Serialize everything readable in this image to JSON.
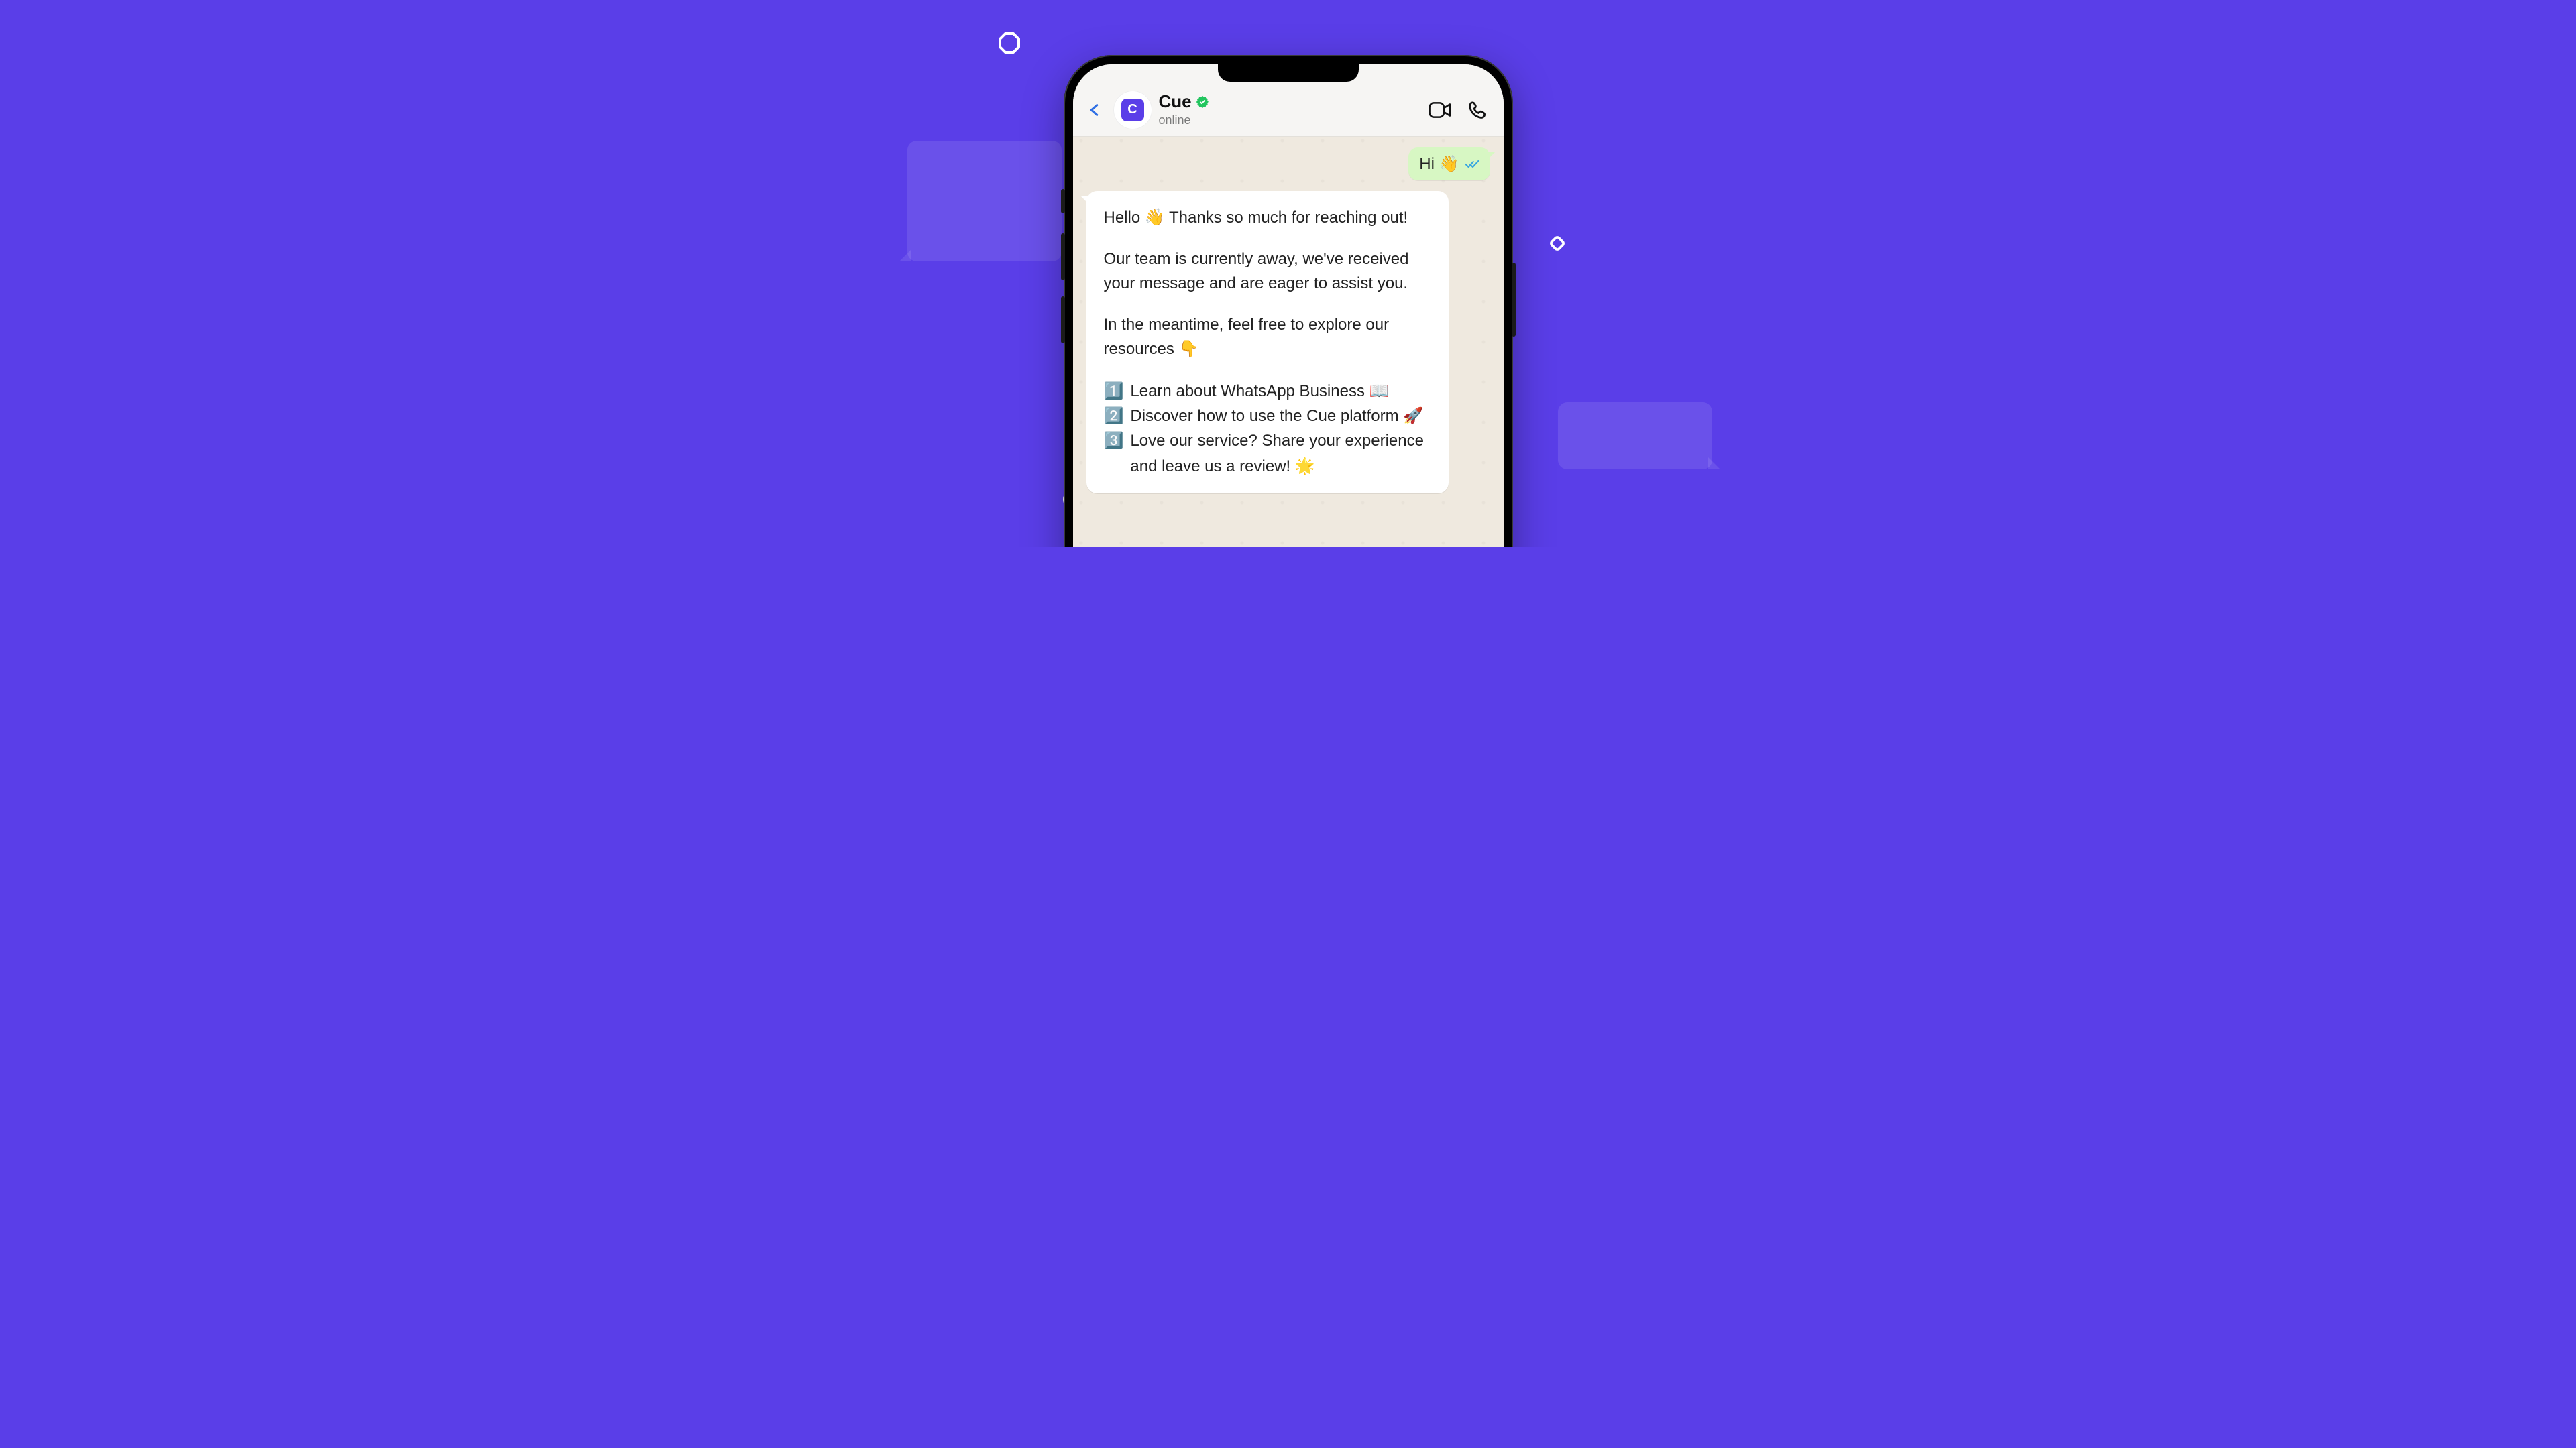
{
  "header": {
    "contact_name": "Cue",
    "status": "online",
    "avatar_letter": "C"
  },
  "messages": {
    "outgoing": {
      "text": "Hi 👋"
    },
    "incoming": {
      "para1": "Hello 👋 Thanks so much for reaching out!",
      "para2": "Our team is currently away, we've received your message and are eager to assist you.",
      "para3": "In the meantime, feel free to explore our resources 👇",
      "options": [
        {
          "num": "1️⃣",
          "text": "Learn about WhatsApp Business 📖"
        },
        {
          "num": "2️⃣",
          "text": "Discover how to use the Cue platform 🚀"
        },
        {
          "num": "3️⃣",
          "text": "Love our service? Share your experience and leave us a review! 🌟"
        }
      ]
    }
  }
}
